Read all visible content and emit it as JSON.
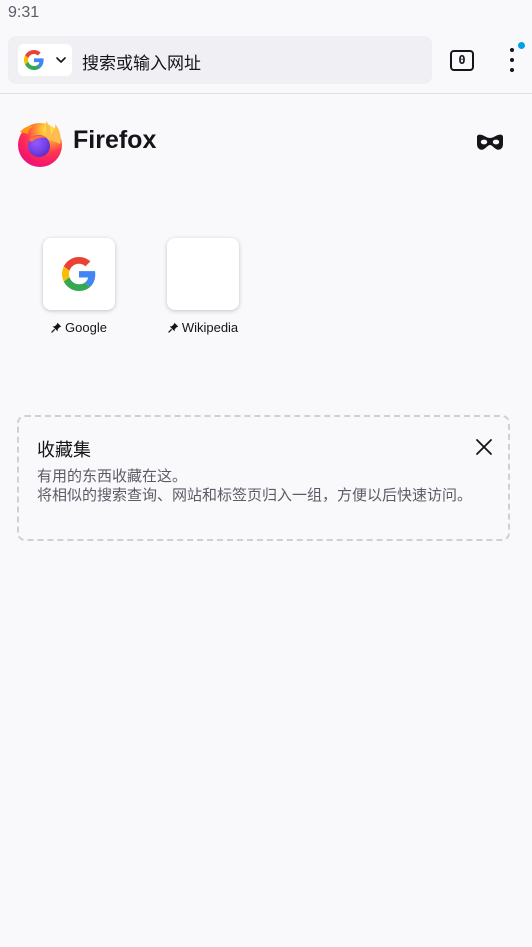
{
  "status_bar": {
    "time": "9:31"
  },
  "toolbar": {
    "search_engine_icon": "google-g-icon",
    "url_placeholder": "搜索或输入网址",
    "tab_count": "0",
    "menu_has_notification": true,
    "notification_color": "#00a2e6"
  },
  "header": {
    "brand_name": "Firefox",
    "private_mode_icon": "private-mask-icon"
  },
  "shortcuts": [
    {
      "label": "Google",
      "icon": "google-g-icon",
      "pinned": true
    },
    {
      "label": "Wikipedia",
      "icon": "blank",
      "pinned": true
    }
  ],
  "collections": {
    "title": "收藏集",
    "line1": "有用的东西收藏在这。",
    "line2": "将相似的搜索查询、网站和标签页归入一组，方便以后快速访问。"
  },
  "colors": {
    "background": "#f9f9fb",
    "text": "#15141a",
    "secondary_text": "#5b5b66",
    "url_bar": "#f0f0f4"
  }
}
